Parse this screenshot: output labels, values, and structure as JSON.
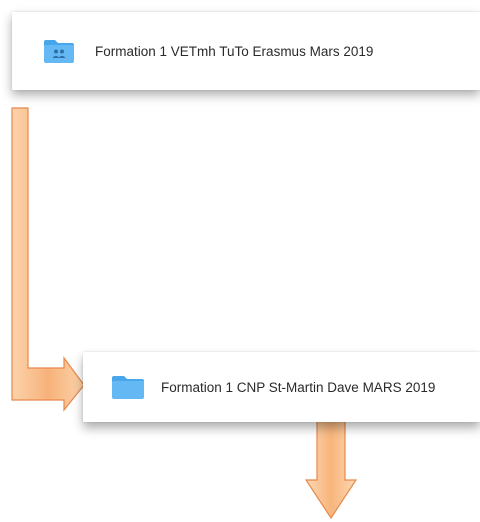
{
  "folders": [
    {
      "name": "Formation 1 VETmh TuTo Erasmus Mars 2019",
      "icon": "shared-folder-icon"
    },
    {
      "name": "Formation 1 CNP St-Martin Dave MARS 2019",
      "icon": "folder-icon"
    }
  ],
  "colors": {
    "folder_blue": "#64b8f4",
    "folder_tab": "#4aa6ea",
    "arrow_fill": "#fbc490",
    "arrow_stroke": "#e8894a"
  }
}
